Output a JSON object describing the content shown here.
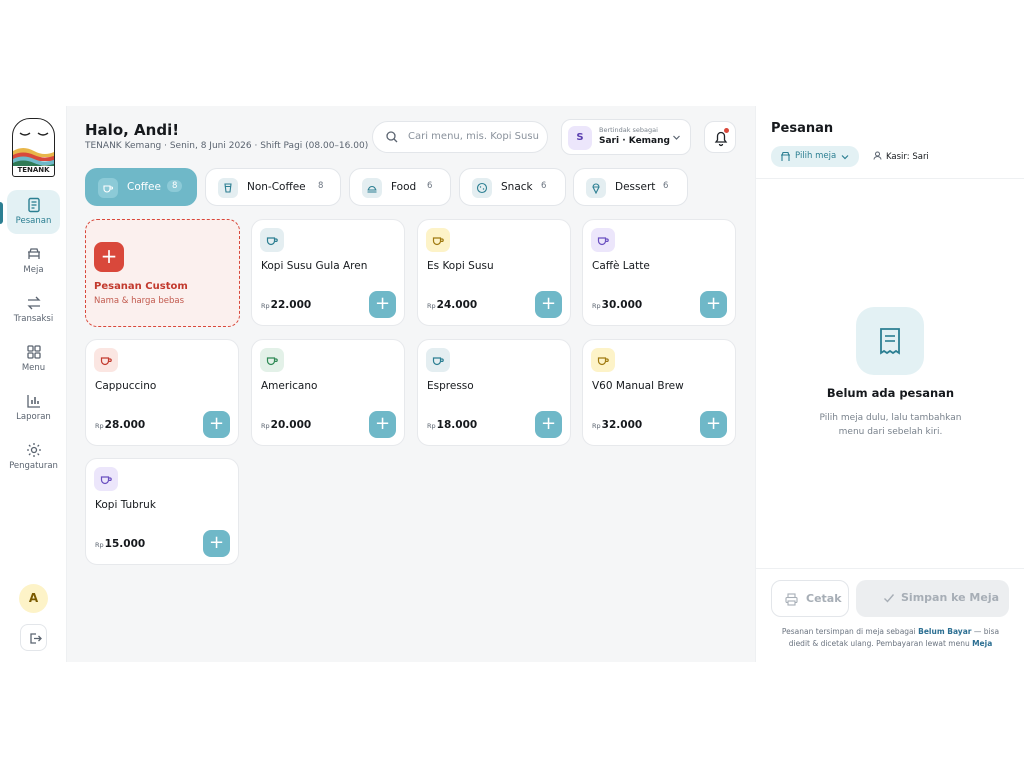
{
  "sidebar": {
    "brand": "TENANK",
    "items": [
      {
        "label": "Pesanan",
        "icon": "receipt-icon",
        "active": true
      },
      {
        "label": "Meja",
        "icon": "table-icon"
      },
      {
        "label": "Transaksi",
        "icon": "transfer-icon"
      },
      {
        "label": "Menu",
        "icon": "grid-icon"
      },
      {
        "label": "Laporan",
        "icon": "bar-chart-icon"
      },
      {
        "label": "Pengaturan",
        "icon": "gear-icon"
      }
    ],
    "avatar_initial": "A"
  },
  "header": {
    "greeting": "Halo, Andi!",
    "subline": "TENANK Kemang · Senin, 8 Juni 2026 · Shift Pagi (08.00–16.00)",
    "search_placeholder": "Cari menu, mis. Kopi Susu",
    "acting_initial": "S",
    "acting_caption": "Bertindak sebagai",
    "acting_name": "Sari · Kemang"
  },
  "tabs": [
    {
      "label": "Coffee",
      "count": "8",
      "active": true
    },
    {
      "label": "Non-Coffee",
      "count": "8"
    },
    {
      "label": "Food",
      "count": "6"
    },
    {
      "label": "Snack",
      "count": "6"
    },
    {
      "label": "Dessert",
      "count": "6"
    }
  ],
  "custom_order": {
    "title": "Pesanan Custom",
    "subtitle": "Nama & harga bebas"
  },
  "currency": "Rp",
  "menu_items": [
    {
      "name": "Kopi Susu Gula Aren",
      "price": "22.000",
      "icon_bg": "#e4eef1",
      "icon_color": "#2c7f92"
    },
    {
      "name": "Es Kopi Susu",
      "price": "24.000",
      "icon_bg": "#fdf3c8",
      "icon_color": "#a07a10"
    },
    {
      "name": "Caffè Latte",
      "price": "30.000",
      "icon_bg": "#ece6fb",
      "icon_color": "#6a4fc0"
    },
    {
      "name": "Cappuccino",
      "price": "28.000",
      "icon_bg": "#fbe6e2",
      "icon_color": "#c23a2e"
    },
    {
      "name": "Americano",
      "price": "20.000",
      "icon_bg": "#e3f1e8",
      "icon_color": "#2f8a55"
    },
    {
      "name": "Espresso",
      "price": "18.000",
      "icon_bg": "#e4eef1",
      "icon_color": "#2c7f92"
    },
    {
      "name": "V60 Manual Brew",
      "price": "32.000",
      "icon_bg": "#fdf3c8",
      "icon_color": "#a07a10"
    },
    {
      "name": "Kopi Tubruk",
      "price": "15.000",
      "icon_bg": "#ece6fb",
      "icon_color": "#6a4fc0"
    }
  ],
  "order_panel": {
    "title": "Pesanan",
    "pick_table": "Pilih meja",
    "cashier": "Kasir: Sari",
    "empty_title": "Belum ada pesanan",
    "empty_line1": "Pilih meja dulu, lalu tambahkan",
    "empty_line2": "menu dari sebelah kiri.",
    "print_label": "Cetak",
    "save_label": "Simpan ke Meja",
    "note_part1": "Pesanan tersimpan di meja sebagai ",
    "note_bold1": "Belum Bayar",
    "note_part2": " — bisa",
    "note_part3": "diedit & dicetak ulang. Pembayaran lewat menu ",
    "note_bold2": "Meja"
  },
  "colors": {
    "accent": "#6fb8c8",
    "accent_dark": "#2c7f92",
    "danger": "#d9483b"
  }
}
